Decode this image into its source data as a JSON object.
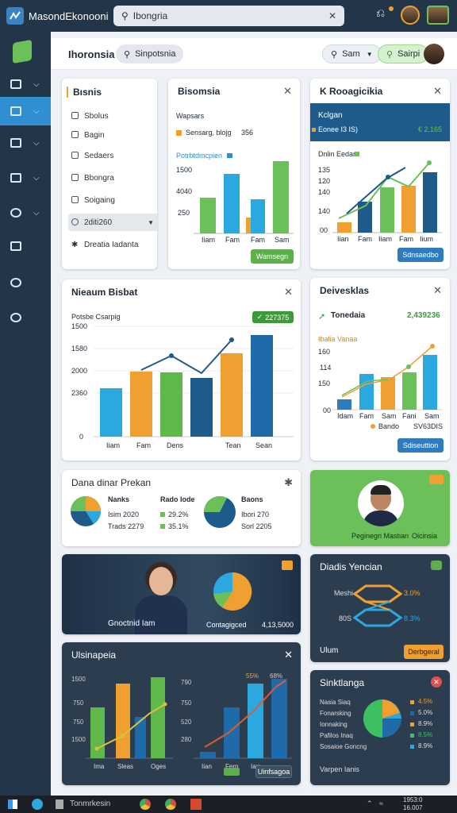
{
  "app": {
    "title": "MasondEkonooni"
  },
  "search": {
    "value": "Ibongria"
  },
  "header": {
    "title": "Ihoronsia",
    "search_chip": "Sinpotsnia",
    "user_pill": "Sam",
    "action_pill": "Sairpi"
  },
  "sidebar": {
    "items": [
      {
        "icon": "folder-icon"
      },
      {
        "icon": "chart-icon"
      },
      {
        "icon": "briefcase-icon"
      },
      {
        "icon": "table-icon"
      },
      {
        "icon": "user-icon"
      },
      {
        "icon": "pie-icon"
      },
      {
        "icon": "headset-icon"
      },
      {
        "icon": "globe-icon"
      }
    ]
  },
  "menu": {
    "title": "Bısnis",
    "items": [
      "Sbolus",
      "Bagin",
      "Sedaers",
      "Bbongra",
      "Soigaing",
      "2diti260",
      "Dreatia Iadanta"
    ]
  },
  "card_bar1": {
    "title": "Bisomsia",
    "subtitle": "Wapsars",
    "legend_label": "Sensarg, blojg",
    "legend_value": "356",
    "series_label": "Potrbtdmcpien",
    "button": "Wamsegn",
    "x_labels": [
      "Iiam",
      "Fam",
      "Fam",
      "Sam"
    ],
    "y_labels": [
      "1500",
      "4040",
      "250"
    ]
  },
  "card_bar2": {
    "title": "K Rooagicikia",
    "label1": "Kclgan",
    "label2": "Eonee I3 IS)",
    "value": "€ 2,165",
    "series_label": "Dnlin Eedan",
    "button": "Sdnsaedbo",
    "x_labels": [
      "Iian",
      "Fam",
      "Iiam",
      "Fam",
      "Iium",
      "Sen"
    ],
    "y_labels": [
      "135",
      "120",
      "140",
      "140",
      "00"
    ]
  },
  "card_main": {
    "title": "Nieaum Bisbat",
    "subtitle": "Potsbe Csarpig",
    "badge": "227375",
    "x_labels": [
      "Iiam",
      "Fam",
      "Dens",
      "Tean",
      "Sean"
    ],
    "y_labels": [
      "1500",
      "1580",
      "2000",
      "2360",
      "0"
    ]
  },
  "card_dev": {
    "title": "Deivesklas",
    "label": "Tonedaia",
    "value": "2,439236",
    "series_label": "Ibalia Vanaa",
    "x_labels": [
      "Idam",
      "Fam",
      "Sam",
      "Fani",
      "Sam"
    ],
    "y_labels": [
      "160",
      "114",
      "150",
      "00"
    ],
    "legend1": "Bando",
    "legend2": "SV63DIS",
    "button": "Sdiseuttion"
  },
  "card_pies": {
    "title": "Dana dinar Prekan",
    "col1_title": "Nanks",
    "col1_a": "Isim 2020",
    "col1_b": "Trads 2279",
    "col2_title": "Rado Iode",
    "col2_a": "29.2%",
    "col2_b": "35.1%",
    "col3_title": "Baons",
    "col3_a": "Ibori 270",
    "col3_b": "Sorl 2205"
  },
  "card_profile": {
    "name": "Peginegri Mastian",
    "role": "Oicinsia"
  },
  "card_video": {
    "caption": "Gnoctnid Iam",
    "pie_label": "Contagigced",
    "value": "4,13,5000"
  },
  "card_diag": {
    "title": "Diadis Yencian",
    "label1": "Meshi",
    "label2": "80S",
    "pct1": "3.0%",
    "pct2": "8.3%",
    "footer": "Ulum",
    "button": "Derbgeral"
  },
  "card_dark_chart": {
    "title": "Ulsinapeia",
    "x_labels": [
      "Ima",
      "Sleas",
      "Oges",
      "Iian",
      "Fern",
      "Iam"
    ],
    "y_labels": [
      "1500",
      "750",
      "750",
      "1500",
      "790",
      "750",
      "520",
      "280"
    ],
    "pct1": "55%",
    "pct2": "68%",
    "button": "Uinfsagoa"
  },
  "card_donut": {
    "title": "Sinktlanga",
    "rows": [
      "Nasia Siaq",
      "Fonarsking",
      "Ionnaking",
      "Pafilos Inaq",
      "Sosaioe Goncng"
    ],
    "pcts": [
      "4.5%",
      "5.0%",
      "8.9%",
      "8.5%",
      "8.9%"
    ],
    "footer": "Varpen Ianis"
  },
  "taskbar": {
    "app_label": "Tonmrkesin",
    "time": "1953:0",
    "date": "16.007"
  }
}
